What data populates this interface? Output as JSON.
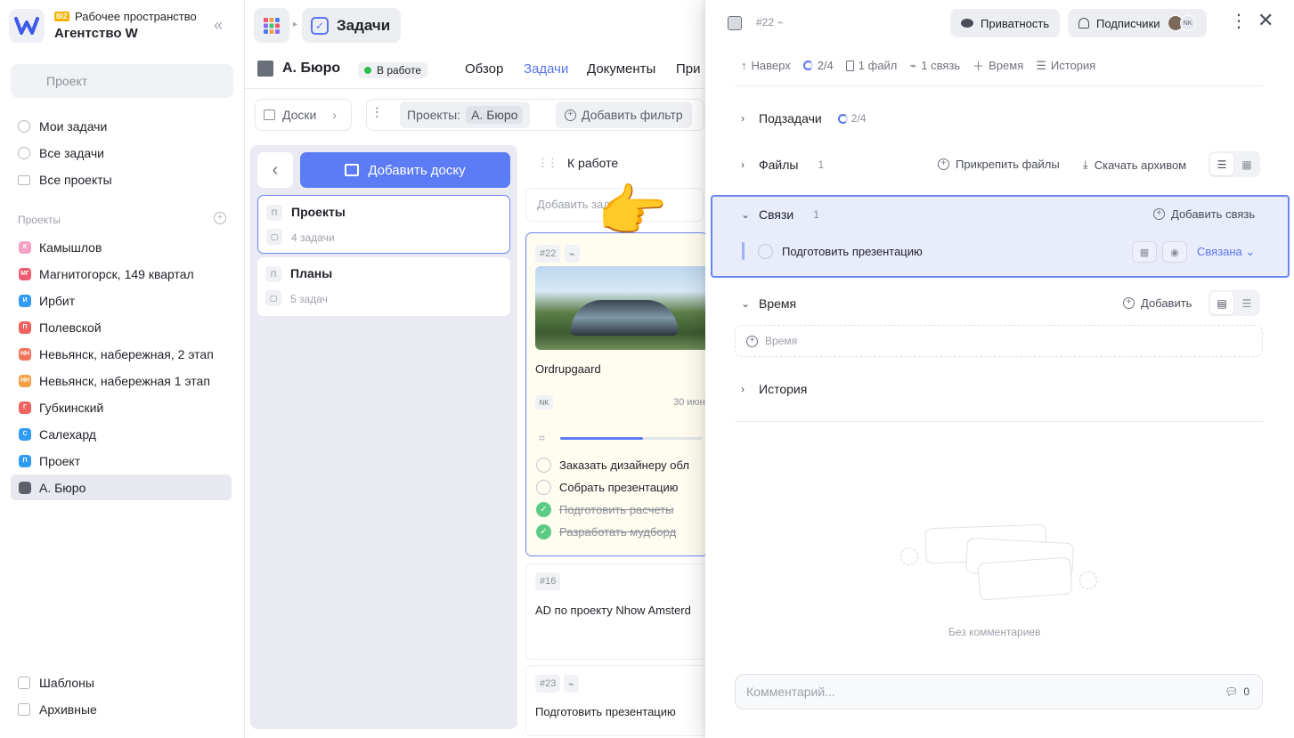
{
  "sidebar": {
    "workspace_badge": "BIZ",
    "workspace_label": "Рабочее пространство",
    "workspace_name": "Агентство W",
    "search_placeholder": "Проект",
    "nav": [
      "Мои задачи",
      "Все задачи",
      "Все проекты"
    ],
    "projects_title": "Проекты",
    "projects": [
      {
        "badge": "К",
        "label": "Камышлов",
        "color": "#f4a3c6"
      },
      {
        "badge": "МГ",
        "label": "Магнитогорск, 149 квартал",
        "color": "#ef5a6f"
      },
      {
        "badge": "И",
        "label": "Ирбит",
        "color": "#2f9bf3"
      },
      {
        "badge": "П",
        "label": "Полевской",
        "color": "#ef6262"
      },
      {
        "badge": "НН",
        "label": "Невьянск, набережная, 2 этап",
        "color": "#f0735a"
      },
      {
        "badge": "НН",
        "label": "Невьянск, набережная 1 этап",
        "color": "#f5a043"
      },
      {
        "badge": "Г",
        "label": "Губкинский",
        "color": "#ef6262"
      },
      {
        "badge": "С",
        "label": "Салехард",
        "color": "#2f9bf3"
      },
      {
        "badge": "П",
        "label": "Проект",
        "color": "#2f9bf3"
      },
      {
        "badge": "",
        "label": "А. Бюро",
        "color": "#5c606a"
      }
    ],
    "footer": [
      "Шаблоны",
      "Архивные"
    ]
  },
  "topbar": {
    "section_label": "Задачи"
  },
  "project": {
    "title": "А. Бюро",
    "status": "В работе",
    "tabs": [
      "Обзор",
      "Задачи",
      "Документы",
      "При"
    ],
    "active_tab": "Задачи"
  },
  "filters": {
    "boards": "Доски",
    "projects_label": "Проекты:",
    "projects_value": "А. Бюро",
    "add_filter": "Добавить фильтр"
  },
  "boards": {
    "add_button": "Добавить доску",
    "items": [
      {
        "badge": "П",
        "title": "Проекты",
        "sub": "4 задачи"
      },
      {
        "badge": "П",
        "title": "Планы",
        "sub": "5 задач"
      }
    ]
  },
  "column": {
    "title": "К работе",
    "add_task": "Добавить задачу",
    "card": {
      "id": "#22",
      "title": "Ordrupgaard",
      "assignee": "NK",
      "date": "30 июн",
      "progress": 0.58,
      "subtasks": [
        {
          "label": "Заказать дизайнеру обл",
          "done": false
        },
        {
          "label": "Собрать презентацию",
          "done": false
        },
        {
          "label": "Подготовить расчеты",
          "done": true
        },
        {
          "label": "Разработать мудборд",
          "done": true
        }
      ]
    },
    "card2": {
      "id": "#16",
      "title": "AD по проекту Nhow Amsterd"
    },
    "card3": {
      "id": "#23",
      "title": "Подготовить презентацию"
    }
  },
  "panel": {
    "task_id": "#22",
    "privacy": "Приватность",
    "subscribers": "Подписчики",
    "subscriber_initials": "NK",
    "meta": {
      "up": "Наверх",
      "subtasks": "2/4",
      "files": "1 файл",
      "links": "1 связь",
      "time": "Время",
      "history": "История"
    },
    "subtasks_section": {
      "title": "Подзадачи",
      "count": "2/4"
    },
    "files_section": {
      "title": "Файлы",
      "count": "1",
      "attach": "Прикрепить файлы",
      "download": "Скачать архивом"
    },
    "links_section": {
      "title": "Связи",
      "count": "1",
      "add": "Добавить связь",
      "item": "Подготовить презентацию",
      "relation": "Связана"
    },
    "time_section": {
      "title": "Время",
      "add": "Добавить",
      "input_label": "Время"
    },
    "history_section": {
      "title": "История"
    },
    "no_comments": "Без комментариев",
    "comment_placeholder": "Комментарий...",
    "comment_count": "0"
  }
}
